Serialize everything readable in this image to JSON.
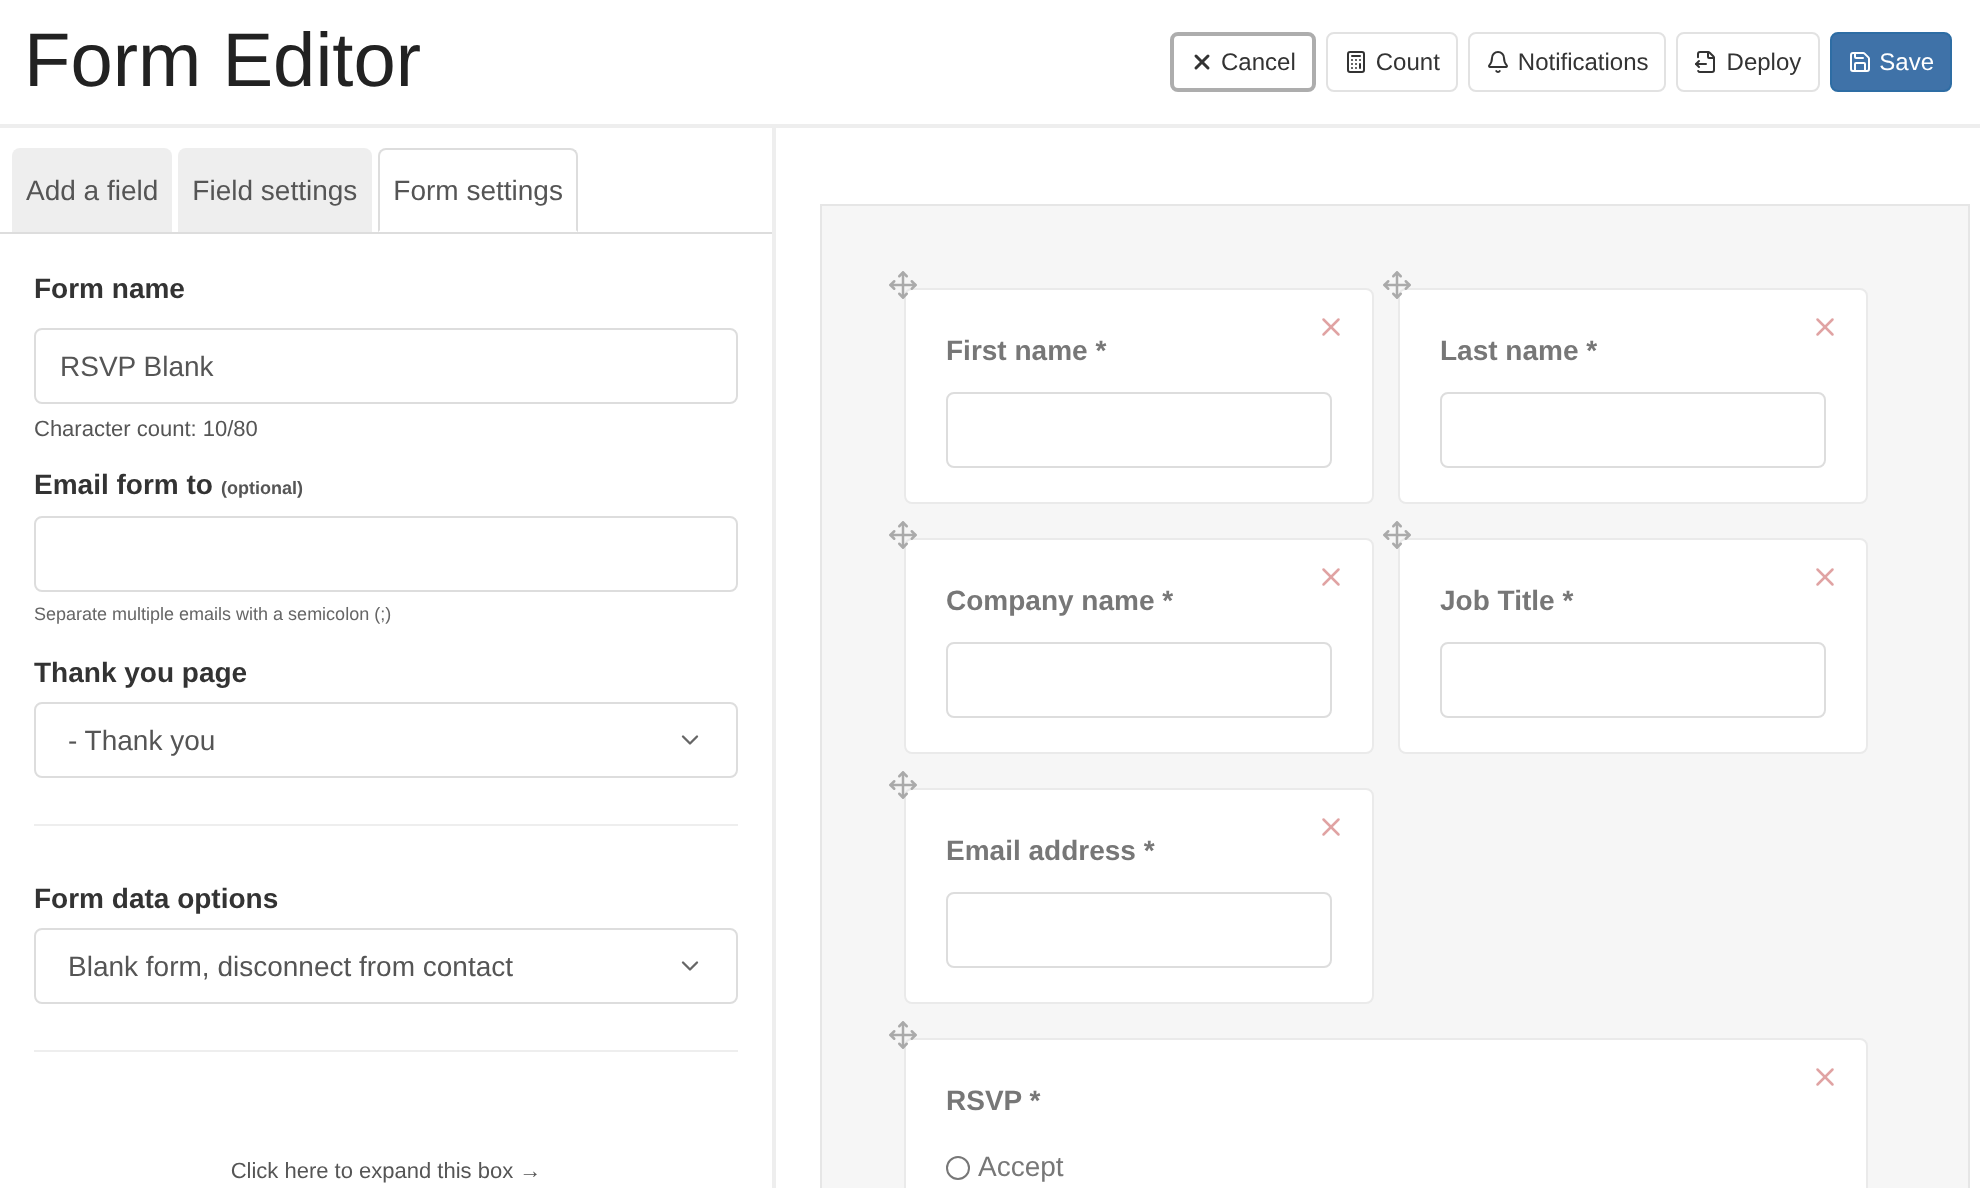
{
  "title": "Form Editor",
  "toolbar": [
    {
      "label": "Cancel",
      "kind": "outline"
    },
    {
      "label": "Count",
      "kind": "default"
    },
    {
      "label": "Notifications",
      "kind": "default"
    },
    {
      "label": "Deploy",
      "kind": "default"
    },
    {
      "label": "Save",
      "kind": "primary"
    }
  ],
  "tabs": [
    {
      "label": "Add a field",
      "selected": false
    },
    {
      "label": "Field settings",
      "selected": false
    },
    {
      "label": "Form settings",
      "selected": true
    }
  ],
  "settings": {
    "form_name": {
      "label": "Form name",
      "value": "RSVP Blank",
      "help": "Character count: 10/80"
    },
    "email": {
      "label": "Email form to",
      "note": "(optional)",
      "help": "Separate multiple emails with a semicolon (;)"
    },
    "thank_you": {
      "label": "Thank you page",
      "value": "- Thank you"
    },
    "data_options": {
      "label": "Form data options",
      "value": "Blank form, disconnect from contact"
    },
    "expand_link": "Click here to expand this box →"
  },
  "fields": [
    {
      "label": "First name *",
      "kind": "text"
    },
    {
      "label": "Last name *",
      "kind": "text"
    },
    {
      "label": "Company name *",
      "kind": "text"
    },
    {
      "label": "Job Title *",
      "kind": "text"
    },
    {
      "label": "Email address *",
      "kind": "text"
    },
    {
      "label": "RSVP *",
      "kind": "radio",
      "options": [
        {
          "label": "Accept",
          "selected": false
        }
      ]
    }
  ]
}
